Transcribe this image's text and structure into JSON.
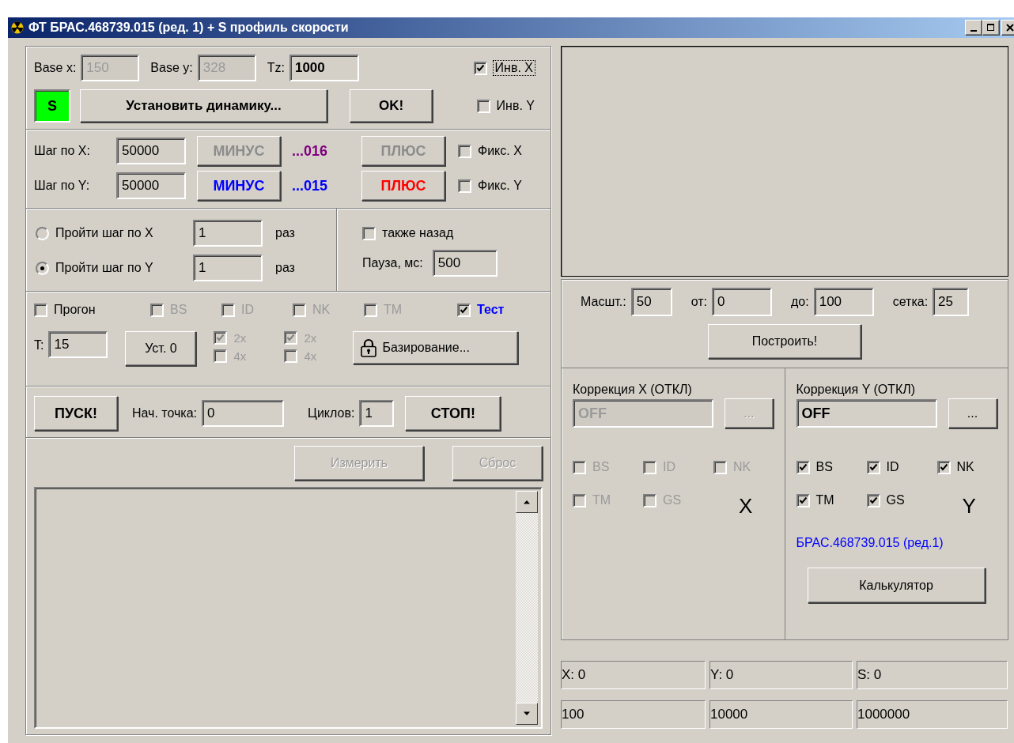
{
  "window": {
    "title": "ФТ БРАС.468739.015 (ред. 1) + S профиль скорости"
  },
  "base": {
    "fields": [
      {
        "label": "Base x:",
        "value": "150",
        "disabled": true
      },
      {
        "label": "Base y:",
        "value": "328",
        "disabled": true
      },
      {
        "label": "Tz:",
        "value": "1000",
        "disabled": false
      }
    ],
    "inversions": [
      {
        "label": "Инв. X",
        "checked": true
      },
      {
        "label": "Инв. Y",
        "checked": false
      }
    ],
    "s_badge": "S",
    "dynamics_button": "Установить динамику...",
    "ok_button": "OK!"
  },
  "steps": [
    {
      "label": "Шаг по X:",
      "value": "50000",
      "minus": "МИНУС",
      "code": "...016",
      "color": "#800080",
      "plus": "ПЛЮС",
      "disabled": true,
      "fix": {
        "label": "Фикс. X",
        "checked": false
      }
    },
    {
      "label": "Шаг по Y:",
      "value": "50000",
      "minus": "МИНУС",
      "code": "...015",
      "color": "#0000ff",
      "plus": "ПЛЮС",
      "disabled": false,
      "fix": {
        "label": "Фикс. Y",
        "checked": false
      }
    }
  ],
  "pass": {
    "options": [
      {
        "label": "Пройти шаг по X",
        "value": "1",
        "unit": "раз",
        "selected": false
      },
      {
        "label": "Пройти шаг по Y",
        "value": "1",
        "unit": "раз",
        "selected": true
      }
    ],
    "back": {
      "label": "также назад",
      "checked": false
    },
    "pause_label": "Пауза, мс:",
    "pause": "500"
  },
  "run_options": {
    "checks": [
      {
        "label": "Прогон",
        "checked": false,
        "disabled": false,
        "kind": "plain"
      },
      {
        "label": "BS",
        "checked": false,
        "disabled": true,
        "kind": "plain"
      },
      {
        "label": "ID",
        "checked": false,
        "disabled": true,
        "kind": "plain"
      },
      {
        "label": "NK",
        "checked": false,
        "disabled": true,
        "kind": "plain"
      },
      {
        "label": "TM",
        "checked": false,
        "disabled": true,
        "kind": "plain"
      },
      {
        "label": "Тест",
        "checked": true,
        "disabled": false,
        "kind": "accent"
      }
    ],
    "t_label": "T:",
    "t": "15",
    "zero_button": "Уст. 0",
    "multipliers": [
      [
        {
          "label": "2x",
          "checked": true,
          "disabled": true
        },
        {
          "label": "4x",
          "checked": false,
          "disabled": true
        }
      ],
      [
        {
          "label": "2x",
          "checked": true,
          "disabled": true
        },
        {
          "label": "4x",
          "checked": false,
          "disabled": true
        }
      ]
    ],
    "basing_button": "Базирование..."
  },
  "run": {
    "start_button": "ПУСК!",
    "start_point_label": "Нач. точка:",
    "start_point": "0",
    "cycles_label": "Циклов:",
    "cycles": "1",
    "stop_button": "СТОП!"
  },
  "measure": {
    "measure_button": "Измерить",
    "reset_button": "Сброс",
    "disabled": true
  },
  "scale": {
    "fields": [
      {
        "label": "Масшт.:",
        "value": "50"
      },
      {
        "label": "от:",
        "value": "0"
      },
      {
        "label": "до:",
        "value": "100"
      },
      {
        "label": "сетка:",
        "value": "25"
      }
    ],
    "build_button": "Построить!"
  },
  "corrections": [
    {
      "title": "Коррекция X (ОТКЛ)",
      "value": "OFF",
      "button": "...",
      "disabled": true,
      "axis": "X",
      "checks": [
        {
          "label": "BS",
          "checked": false
        },
        {
          "label": "ID",
          "checked": false
        },
        {
          "label": "NK",
          "checked": false
        },
        {
          "label": "TM",
          "checked": false
        },
        {
          "label": "GS",
          "checked": false
        }
      ]
    },
    {
      "title": "Коррекция Y (ОТКЛ)",
      "value": "OFF",
      "button": "...",
      "disabled": false,
      "axis": "Y",
      "checks": [
        {
          "label": "BS",
          "checked": true
        },
        {
          "label": "ID",
          "checked": true
        },
        {
          "label": "NK",
          "checked": true
        },
        {
          "label": "TM",
          "checked": true
        },
        {
          "label": "GS",
          "checked": true
        }
      ],
      "note": "БРАС.468739.015 (ред.1)",
      "calc_button": "Калькулятор"
    }
  ],
  "readouts": [
    [
      "X: 0",
      "Y: 0",
      "S: 0"
    ],
    [
      "100",
      "10000",
      "1000000"
    ]
  ]
}
